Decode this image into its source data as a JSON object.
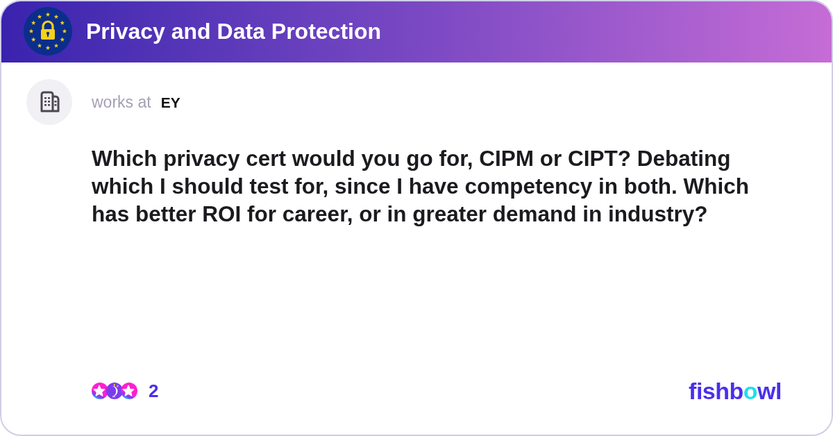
{
  "header": {
    "title": "Privacy and Data Protection"
  },
  "author": {
    "label": "works at",
    "company": "EY"
  },
  "post": {
    "text": "Which privacy cert would you go for, CIPM or CIPT? Debating which I should test for, since I have competency in both. Which has better ROI for career, or in greater demand in industry?"
  },
  "reactions": {
    "items": [
      {
        "kind": "star"
      },
      {
        "kind": "bulb"
      },
      {
        "kind": "star"
      }
    ],
    "count": "2"
  },
  "brand": {
    "text_before": "fishb",
    "text_highlight": "o",
    "text_after": "wl"
  }
}
